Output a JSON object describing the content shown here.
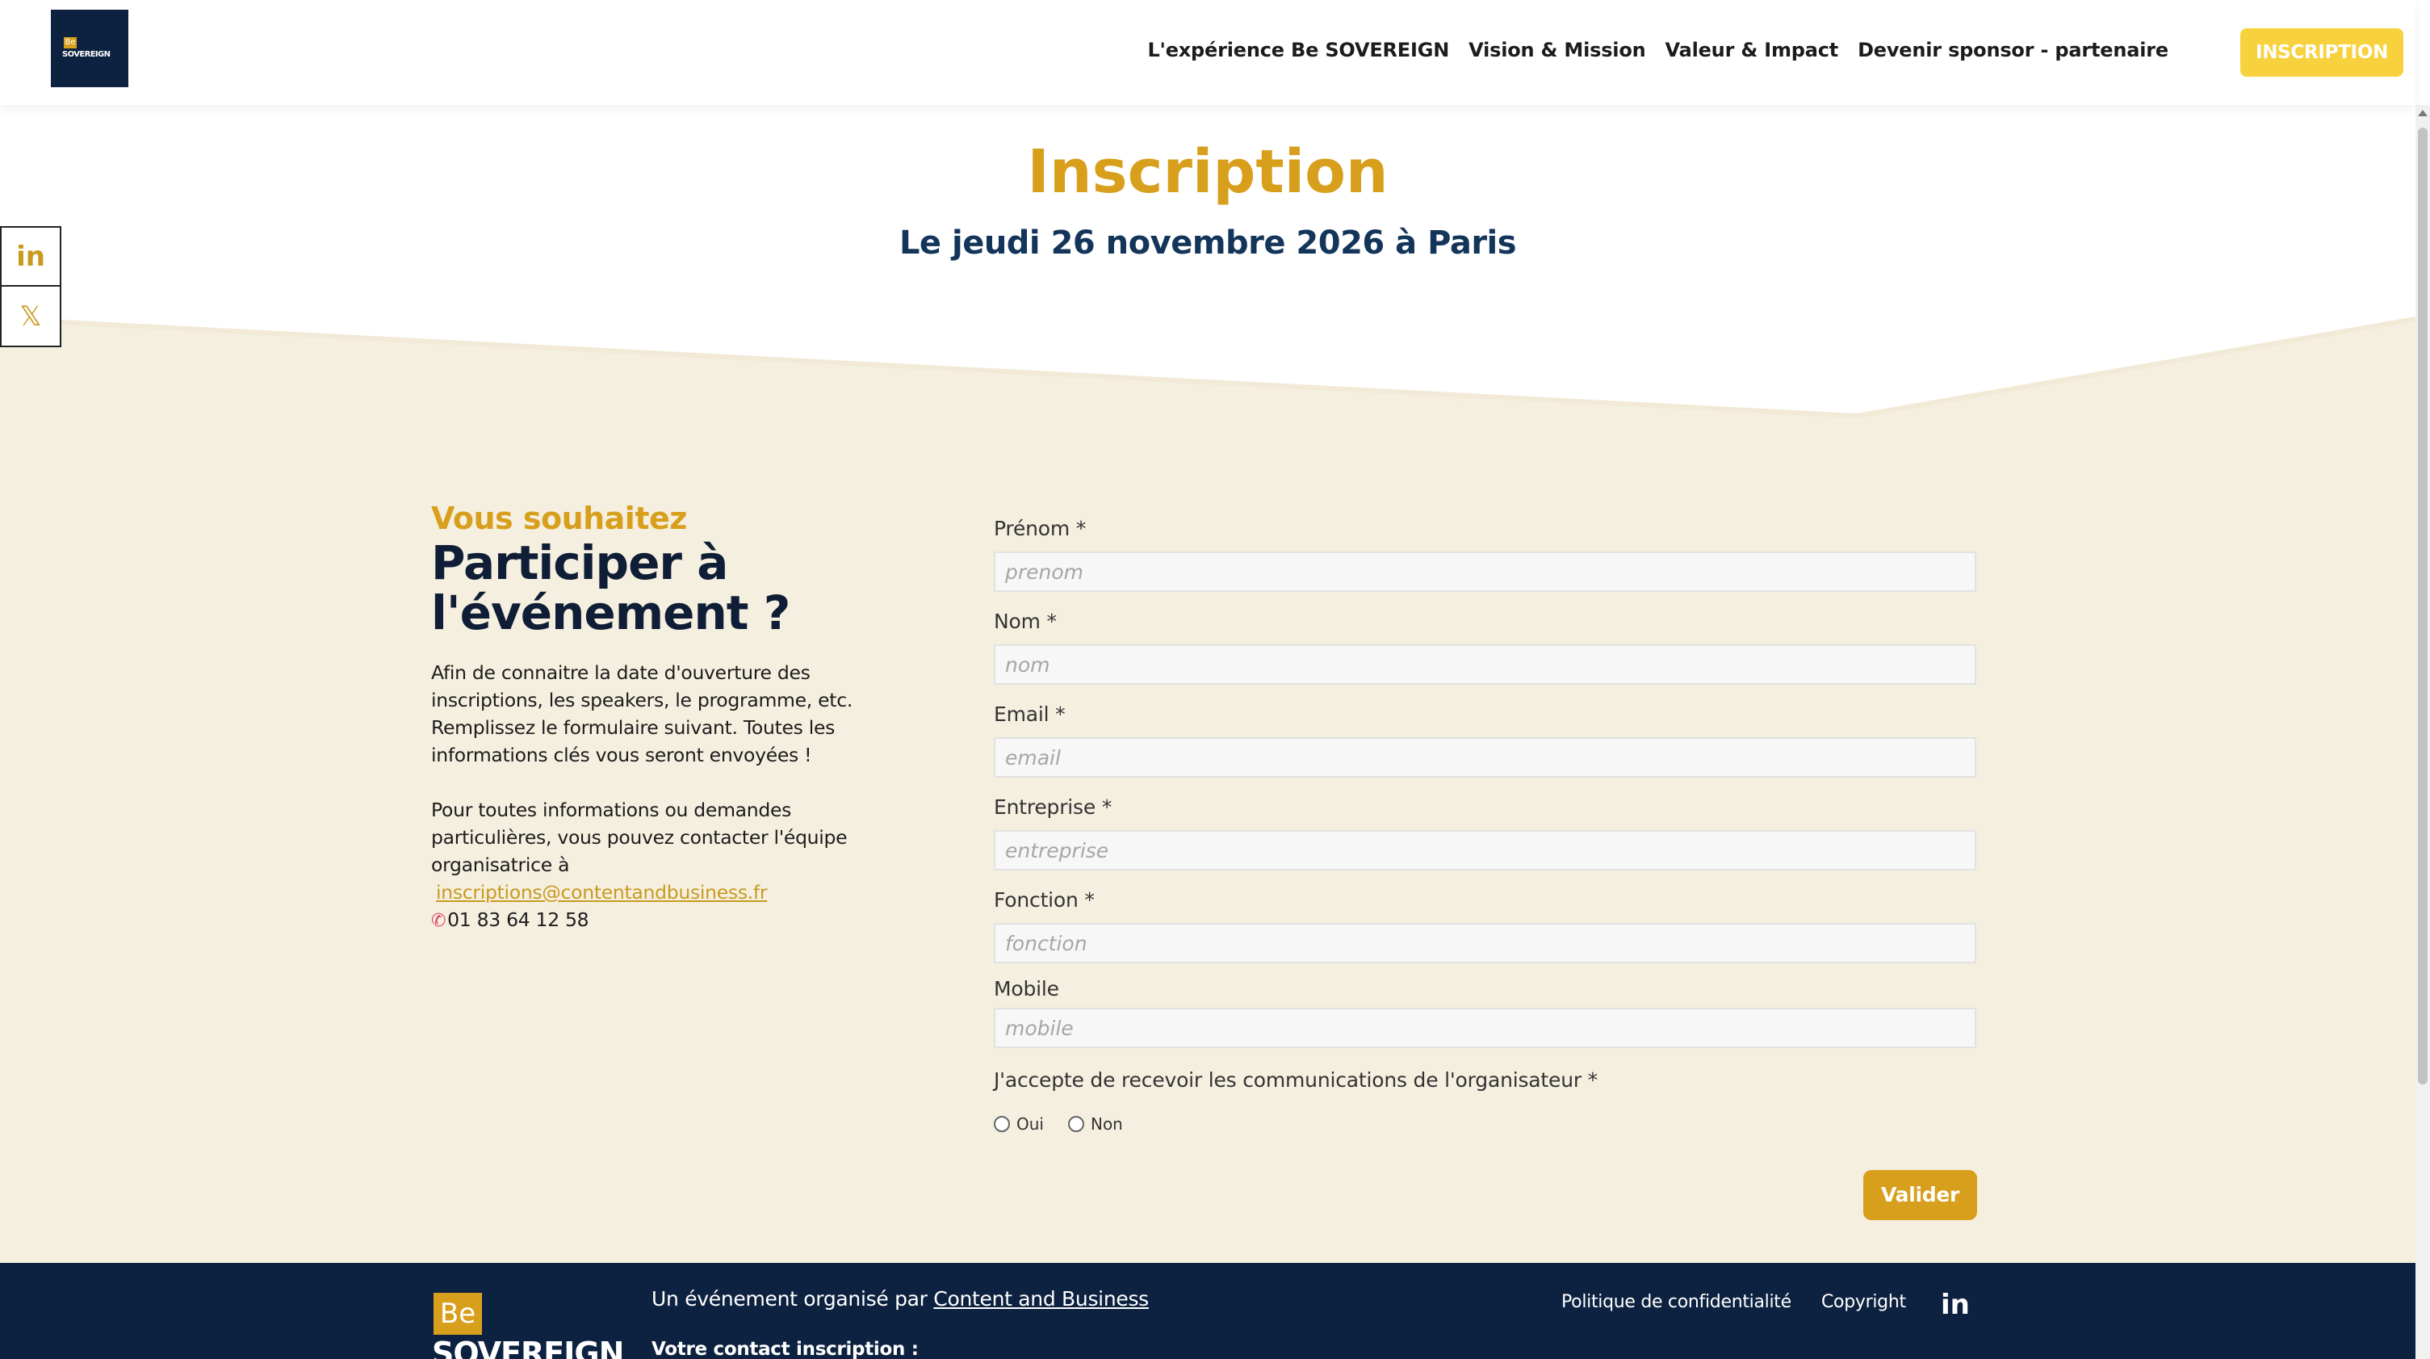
{
  "header": {
    "logo_alt": "Be SOVEREIGN",
    "logo_be": "Be",
    "logo_sovereign": "SOVEREIGN",
    "nav": [
      "L'expérience Be SOVEREIGN",
      "Vision & Mission",
      "Valeur & Impact",
      "Devenir sponsor - partenaire"
    ],
    "cta": "INSCRIPTION"
  },
  "social": {
    "linkedin": "in",
    "x": "𝕏"
  },
  "hero": {
    "title": "Inscription",
    "subtitle": "Le jeudi 26 novembre 2026 à Paris"
  },
  "intro": {
    "pre_title": "Vous souhaitez",
    "title_line1": "Participer à",
    "title_line2": "l'événement ?",
    "paragraph1": "Afin de connaitre la date d'ouverture des inscriptions, les speakers, le programme, etc. Remplissez le formulaire suivant. Toutes les informations clés vous seront envoyées !",
    "paragraph2": "Pour toutes informations ou demandes particulières, vous pouvez contacter l'équipe organisatrice à",
    "email": "inscriptions@contentandbusiness.fr",
    "phone": "01 83 64 12 58"
  },
  "form": {
    "fields": [
      {
        "label": "Prénom",
        "required": "*",
        "placeholder": "prenom"
      },
      {
        "label": "Nom",
        "required": "*",
        "placeholder": "nom"
      },
      {
        "label": "Email",
        "required": "*",
        "placeholder": "email"
      },
      {
        "label": "Entreprise",
        "required": "*",
        "placeholder": "entreprise"
      },
      {
        "label": "Fonction",
        "required": "*",
        "placeholder": "fonction"
      },
      {
        "label": "Mobile",
        "required": "",
        "placeholder": "mobile"
      }
    ],
    "consent_label": "J'accepte de recevoir les communications de l'organisateur",
    "consent_required": "*",
    "options": [
      "Oui",
      "Non"
    ],
    "submit": "Valider"
  },
  "footer": {
    "organised_by": "Un événement organisé par",
    "organizer_link": "Content and Business",
    "contact_label": "Votre contact inscription :",
    "privacy": "Politique de confidentialité",
    "copyright": "Copyright",
    "linkedin": "in",
    "logo_be": "Be",
    "logo_sovereign": "SOVEREIGN"
  },
  "colors": {
    "gold": "#d89f1c",
    "navy": "#0d2240",
    "cream": "#f5efe0",
    "cta_yellow": "#f7d23e"
  }
}
